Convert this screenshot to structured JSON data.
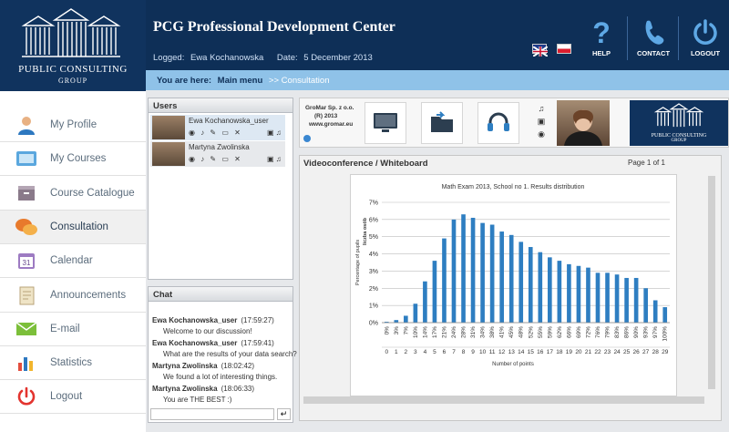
{
  "brand": {
    "line1": "PUBLIC CONSULTING",
    "line2": "GROUP"
  },
  "header": {
    "title": "PCG Professional Development Center",
    "logged_label": "Logged:",
    "user": "Ewa Kochanowska",
    "date_label": "Date:",
    "date": "5 December 2013",
    "help": "HELP",
    "contact": "CONTACT",
    "logout": "LOGOUT"
  },
  "breadcrumb": {
    "prefix": "You are here:",
    "main": "Main menu",
    "sep": ">>",
    "current": "Consultation"
  },
  "sidebar": {
    "active": "Consultation",
    "items": [
      {
        "label": "My Profile",
        "icon": "profile-icon"
      },
      {
        "label": "My Courses",
        "icon": "courses-icon"
      },
      {
        "label": "Course Catalogue",
        "icon": "catalogue-icon"
      },
      {
        "label": "Consultation",
        "icon": "consultation-icon"
      },
      {
        "label": "Calendar",
        "icon": "calendar-icon"
      },
      {
        "label": "Announcements",
        "icon": "announcements-icon"
      },
      {
        "label": "E-mail",
        "icon": "email-icon"
      },
      {
        "label": "Statistics",
        "icon": "statistics-icon"
      },
      {
        "label": "Logout",
        "icon": "power-icon"
      }
    ]
  },
  "users": {
    "title": "Users",
    "list": [
      {
        "name": "Ewa Kochanowska_user"
      },
      {
        "name": "Martyna Zwolinska"
      }
    ]
  },
  "chat": {
    "title": "Chat",
    "messages": [
      {
        "author": "Ewa Kochanowska_user",
        "time": "(17:59:27)",
        "text": "Welcome to our discussion!"
      },
      {
        "author": "Ewa Kochanowska_user",
        "time": "(17:59:41)",
        "text": "What are the results of your data search?"
      },
      {
        "author": "Martyna Zwolinska",
        "time": "(18:02:42)",
        "text": "We found  a lot of interesting things."
      },
      {
        "author": "Martyna Zwolinska",
        "time": "(18:06:33)",
        "text": "You are THE BEST :)"
      }
    ],
    "input_value": "",
    "send_symbol": "↵"
  },
  "toolbar": {
    "company_lines": [
      "GroMar Sp. z o.o.",
      "(R) 2013",
      "www.gromar.eu"
    ],
    "calendar_day": "31"
  },
  "videoconf": {
    "title": "Videoconference / Whiteboard",
    "page": "Page 1 of 1"
  },
  "chart_data": {
    "type": "bar",
    "title": "Math Exam 2013, School no 1. Results distribution",
    "xlabel": "Number of points",
    "ylabel": "Percentage of pupils",
    "ylabel_word": "liczba osób",
    "ylim": [
      0,
      7
    ],
    "yticks": [
      "0%",
      "1%",
      "2%",
      "3%",
      "4%",
      "5%",
      "6%",
      "7%"
    ],
    "grid": true,
    "categories": [
      "0",
      "1",
      "2",
      "3",
      "4",
      "5",
      "6",
      "7",
      "8",
      "9",
      "10",
      "11",
      "12",
      "13",
      "14",
      "15",
      "16",
      "17",
      "18",
      "19",
      "20",
      "21",
      "22",
      "23",
      "24",
      "25",
      "26",
      "27",
      "28",
      "29"
    ],
    "pct_labels": [
      "0%",
      "3%",
      "7%",
      "10%",
      "14%",
      "17%",
      "21%",
      "24%",
      "28%",
      "31%",
      "34%",
      "38%",
      "41%",
      "45%",
      "48%",
      "52%",
      "55%",
      "59%",
      "62%",
      "66%",
      "69%",
      "72%",
      "76%",
      "79%",
      "83%",
      "86%",
      "90%",
      "93%",
      "97%",
      "100%"
    ],
    "values": [
      0.05,
      0.15,
      0.4,
      1.1,
      2.4,
      3.6,
      4.9,
      6.0,
      6.3,
      6.1,
      5.8,
      5.7,
      5.3,
      5.1,
      4.7,
      4.4,
      4.1,
      3.8,
      3.6,
      3.4,
      3.3,
      3.2,
      2.9,
      2.9,
      2.8,
      2.6,
      2.6,
      2.0,
      1.3,
      0.9
    ]
  },
  "colors": {
    "navy": "#0e2f57",
    "bar": "#2e7ec1",
    "breadcrumb": "#8fc2e8"
  }
}
